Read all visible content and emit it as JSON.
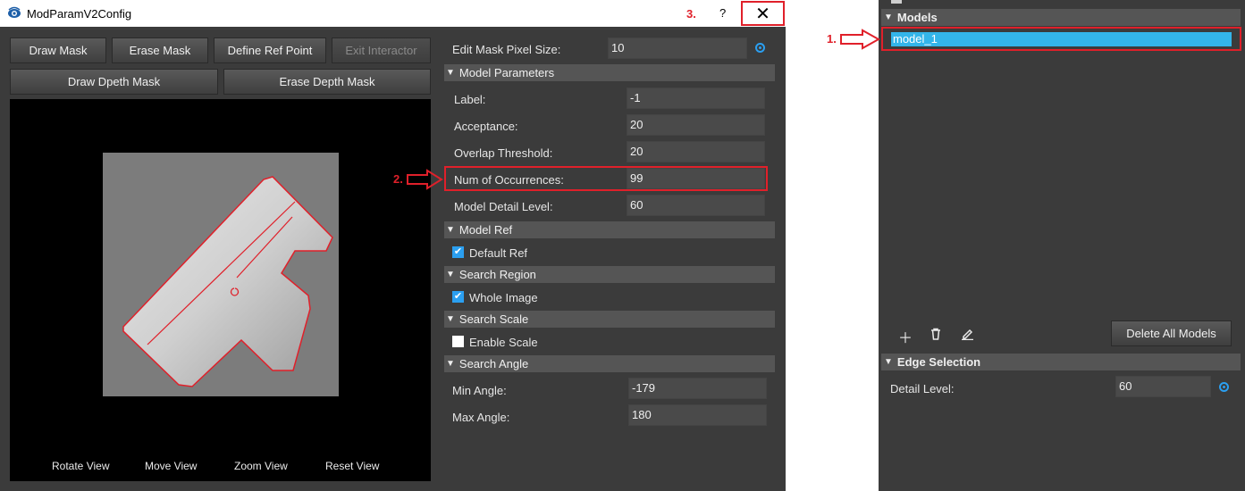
{
  "window": {
    "title": "ModParamV2Config",
    "help_label": "?",
    "close_label": "✕"
  },
  "toolbar": {
    "draw_mask": "Draw Mask",
    "erase_mask": "Erase Mask",
    "define_ref_point": "Define Ref Point",
    "exit_interactor": "Exit Interactor",
    "draw_depth_mask": "Draw Dpeth Mask",
    "erase_depth_mask": "Erase Depth Mask"
  },
  "view_controls": {
    "rotate": "Rotate View",
    "move": "Move View",
    "zoom": "Zoom View",
    "reset": "Reset View"
  },
  "edit_mask": {
    "label": "Edit Mask Pixel Size:",
    "value": "10"
  },
  "sections": {
    "model_parameters": "Model Parameters",
    "model_ref": "Model Ref",
    "search_region": "Search Region",
    "search_scale": "Search Scale",
    "search_angle": "Search Angle"
  },
  "model_parameters": [
    {
      "label": "Label:",
      "value": "-1"
    },
    {
      "label": "Acceptance:",
      "value": "20"
    },
    {
      "label": "Overlap Threshold:",
      "value": "20"
    },
    {
      "label": "Num of Occurrences:",
      "value": "99"
    },
    {
      "label": "Model Detail Level:",
      "value": "60"
    }
  ],
  "checkboxes": {
    "default_ref": {
      "label": "Default Ref",
      "checked": true
    },
    "whole_image": {
      "label": "Whole Image",
      "checked": true
    },
    "enable_scale": {
      "label": "Enable Scale",
      "checked": false
    }
  },
  "search_angle": {
    "min_label": "Min Angle:",
    "min_value": "-179",
    "max_label": "Max Angle:",
    "max_value": "180"
  },
  "annotations": {
    "one": "1.",
    "two": "2.",
    "three": "3."
  },
  "right_panel": {
    "models_header": "Models",
    "model_items": [
      "model_1"
    ],
    "delete_all": "Delete All Models",
    "edge_header": "Edge Selection",
    "detail_label": "Detail Level:",
    "detail_value": "60"
  },
  "colors": {
    "accent": "#2b9ff0",
    "selection": "#33b5ea",
    "annotation_red": "#e0202a",
    "panel_bg": "#3b3b3b"
  }
}
